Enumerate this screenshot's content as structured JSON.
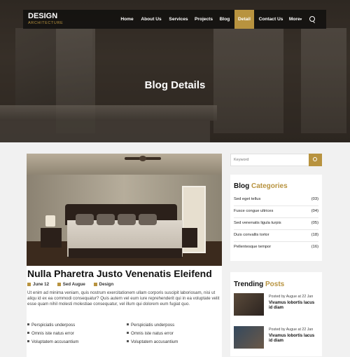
{
  "brand": {
    "name": "DESIGN",
    "tagline": "ARCHITECTURE",
    "accent_color": "#b8933f"
  },
  "nav": {
    "items": [
      {
        "label": "Home",
        "active": false
      },
      {
        "label": "About Us",
        "active": false
      },
      {
        "label": "Services",
        "active": false
      },
      {
        "label": "Projects",
        "active": false
      },
      {
        "label": "Blog",
        "active": false
      },
      {
        "label": "Detail",
        "active": true
      },
      {
        "label": "Contact Us",
        "active": false
      },
      {
        "label": "More",
        "active": false,
        "icon": "chevron-down-icon"
      }
    ],
    "search_icon": "search-icon"
  },
  "hero": {
    "title": "Blog Details"
  },
  "post": {
    "title": "Nulla Pharetra Justo Venenatis Eleifend",
    "meta": {
      "date": "June 12",
      "author": "Sed Augue",
      "category": "Design"
    },
    "body": "Ut enim ad minima veniam, quis nostrum exercitationem ullam corporis suscipit laboriosam, nisi ut aliqu id ex ea commodi consequatur? Quis autem vel eum iure reprehenderit qui in ea voluptate velit esse quam nihil molesti molestiae consequatur, vel illum qui dolorem eum fugiat quo.",
    "bullets_left": [
      "Perspiciatis underposs",
      "Omnis iste natus error",
      "Voluptatem accusantium"
    ],
    "bullets_right": [
      "Perspiciatis underposs",
      "Omnis iste natus error",
      "Voluptatem accusantium"
    ]
  },
  "sidebar": {
    "search": {
      "placeholder": "Keyword"
    },
    "categories": {
      "title": "Blog",
      "title_accent": "Categories",
      "items": [
        {
          "name": "Sed eget tellus",
          "count": "(03)"
        },
        {
          "name": "Fusce congue ultrices",
          "count": "(04)"
        },
        {
          "name": "Sed venenatis ligula turpis",
          "count": "(05)"
        },
        {
          "name": "Duis convallis tortor",
          "count": "(18)"
        },
        {
          "name": "Pellentesque tempor",
          "count": "(16)"
        }
      ]
    },
    "trending": {
      "title": "Trending",
      "title_accent": "Posts",
      "items": [
        {
          "byline": "Posted by Augue at 22 Jan",
          "title": "Vivamus lobortis lacus id diam"
        },
        {
          "byline": "Posted by Augue at 22 Jan",
          "title": "Vivamus lobortis lacus id diam"
        }
      ]
    }
  }
}
